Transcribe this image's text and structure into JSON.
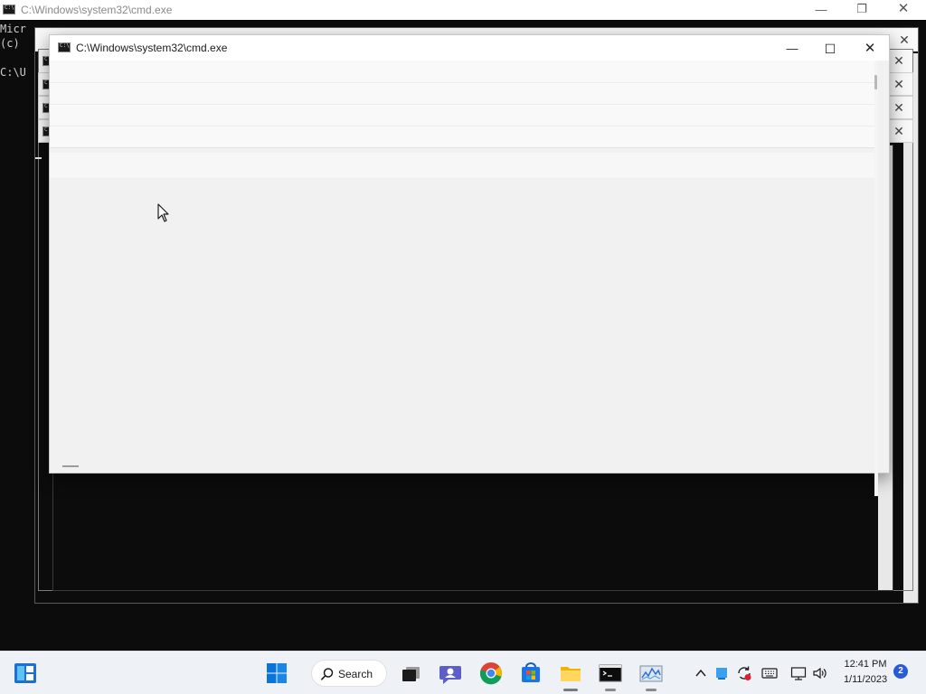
{
  "background_console": {
    "title": "C:\\Windows\\system32\\cmd.exe",
    "lines": [
      "Micr",
      "(c)",
      "",
      "C:\\U"
    ]
  },
  "front_window": {
    "title": "C:\\Windows\\system32\\cmd.exe"
  },
  "taskbar": {
    "search_label": "Search",
    "clock_time": "12:41 PM",
    "clock_date": "1/11/2023",
    "notification_count": "2",
    "apps": [
      {
        "name": "Start",
        "icon": "windows-logo-icon"
      },
      {
        "name": "Search",
        "icon": "search-icon"
      },
      {
        "name": "Task View",
        "icon": "task-view-icon"
      },
      {
        "name": "Chat",
        "icon": "chat-icon"
      },
      {
        "name": "Google Chrome",
        "icon": "chrome-icon"
      },
      {
        "name": "Microsoft Store",
        "icon": "store-icon"
      },
      {
        "name": "File Explorer",
        "icon": "folder-icon"
      },
      {
        "name": "Command Prompt",
        "icon": "terminal-icon"
      },
      {
        "name": "Performance Monitor",
        "icon": "performance-monitor-icon"
      }
    ]
  },
  "colors": {
    "console_bg": "#0c0c0c",
    "taskbar_bg": "#eef1f6",
    "accent": "#2a5bd7"
  }
}
